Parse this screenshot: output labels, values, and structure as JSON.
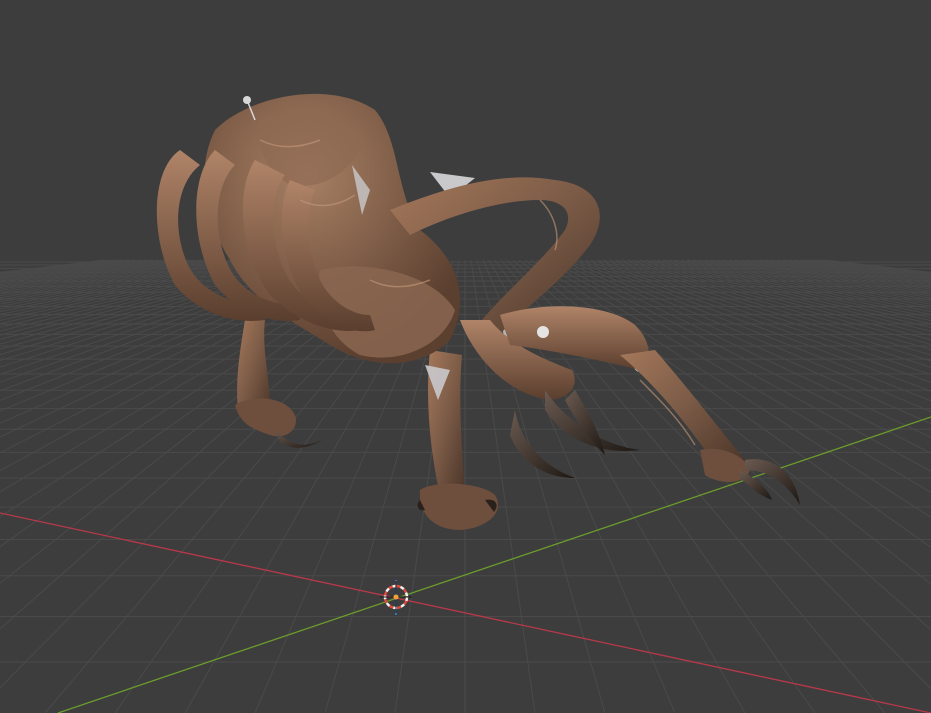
{
  "viewport": {
    "background_color": "#3d3d3d",
    "grid_color": "#4a4a4a",
    "x_axis_color": "#b8384a",
    "y_axis_color": "#6b9c2c",
    "cursor_colors": {
      "ring_red": "#e04a3c",
      "ring_white": "#f2f2f2",
      "origin_dot": "#f2a13a",
      "z_marker": "#3a8ad8"
    },
    "model_colors": {
      "skin_base": "#7a5a46",
      "skin_light": "#a5785a",
      "skin_dark": "#4a3428",
      "claw": "#3a2e28",
      "membrane": "#c9c9cc"
    }
  }
}
